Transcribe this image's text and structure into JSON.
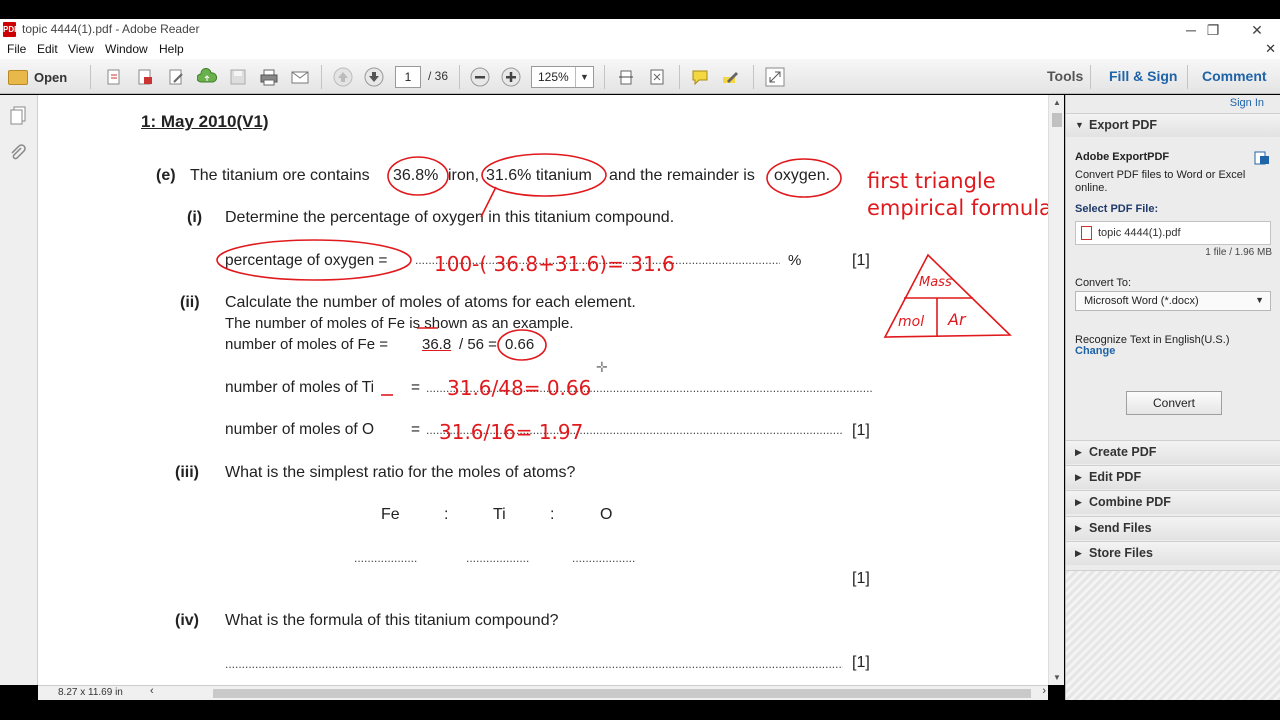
{
  "window": {
    "title": "topic 4444(1).pdf - Adobe Reader",
    "icon_label": "PDF",
    "controls": {
      "minimize": "─",
      "restore": "❐",
      "close": "✕"
    }
  },
  "menu": {
    "items": [
      "File",
      "Edit",
      "View",
      "Window",
      "Help"
    ],
    "close_glyph": "✕"
  },
  "toolbar": {
    "open_label": "Open",
    "page_current": "1",
    "page_total": "/ 36",
    "zoom": "125%",
    "tabs": {
      "tools": "Tools",
      "fill_sign": "Fill & Sign",
      "comment": "Comment"
    }
  },
  "statusbar": {
    "page_size": "8.27 x 11.69 in"
  },
  "pdf": {
    "heading": "1: May 2010(V1)",
    "q_e_label": "(e)",
    "q_e_text_parts": [
      "The titanium ore contains",
      "36.8%",
      "iron,",
      "31.6% titanium",
      "and the remainder is",
      "oxygen."
    ],
    "q_i_label": "(i)",
    "q_i_text": "Determine the percentage of oxygen in this titanium compound.",
    "q_i_answer_label": "percentage of oxygen =",
    "q_i_unit": "%",
    "mark1": "[1]",
    "q_ii_label": "(ii)",
    "q_ii_line1": "Calculate the number of moles of atoms for each element.",
    "q_ii_line2": "The number of moles of Fe is shown as an example.",
    "q_ii_line3_a": "number of moles of Fe =",
    "q_ii_line3_b": "36.8",
    "q_ii_line3_c": "/ 56 =",
    "q_ii_line3_d": "0.66",
    "q_ii_ti_label": "number of moles of Ti",
    "q_ii_o_label": "number of moles of O",
    "equals": "=",
    "q_iii_label": "(iii)",
    "q_iii_text": "What is the simplest ratio for the moles of atoms?",
    "ratio_elements": [
      "Fe",
      ":",
      "Ti",
      ":",
      "O"
    ],
    "q_iv_label": "(iv)",
    "q_iv_text": "What is the formula of this titanium compound?"
  },
  "handwriting": {
    "note_line1": "first triangle",
    "note_line2": "empirical formula",
    "oxygen_calc": "100-( 36.8+31.6)= 31.6",
    "ti_calc": "31.6/48= 0.66",
    "o_calc": "31.6/16= 1.97",
    "triangle_top": "Mass",
    "triangle_bl": "mol",
    "triangle_br": "Ar"
  },
  "right_panel": {
    "sign_in": "Sign In",
    "export_pdf": "Export PDF",
    "adobe_exportpdf": "Adobe ExportPDF",
    "description": "Convert PDF files to Word or Excel online.",
    "select_label": "Select PDF File:",
    "file_name": "topic 4444(1).pdf",
    "file_info": "1 file / 1.96 MB",
    "convert_to": "Convert To:",
    "format": "Microsoft Word (*.docx)",
    "recognize": "Recognize Text in English(U.S.)",
    "change": "Change",
    "convert_btn": "Convert",
    "sections": [
      "Create PDF",
      "Edit PDF",
      "Combine PDF",
      "Send Files",
      "Store Files"
    ]
  },
  "colors": {
    "annotation_red": "#e0191d",
    "link_blue": "#1f63a8",
    "folder_yellow": "#e8b84a"
  }
}
